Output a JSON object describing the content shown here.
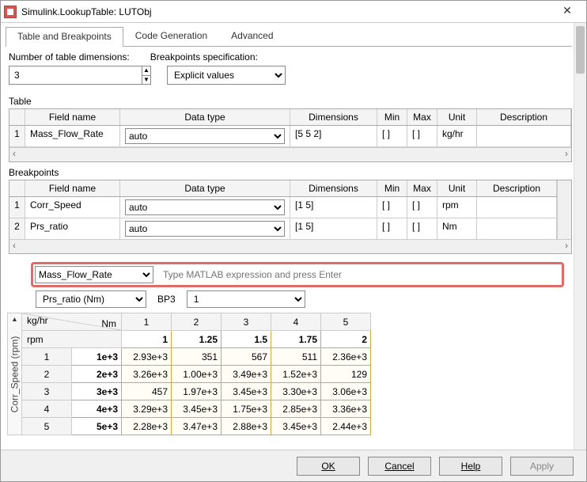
{
  "window": {
    "title": "Simulink.LookupTable: LUTObj"
  },
  "tabs": {
    "t1": "Table and Breakpoints",
    "t2": "Code Generation",
    "t3": "Advanced"
  },
  "labels": {
    "numDims": "Number of table dimensions:",
    "bpSpec": "Breakpoints specification:",
    "table": "Table",
    "breakpoints": "Breakpoints",
    "bp3": "BP3",
    "yaxis": "Corr_Speed (rpm)"
  },
  "inputs": {
    "numDims": "3",
    "bpSpec": "Explicit values",
    "exprSelect": "Mass_Flow_Rate",
    "exprPlaceholder": "Type MATLAB expression and press Enter",
    "filter1": "Prs_ratio (Nm)",
    "bp3val": "1"
  },
  "headers": {
    "fieldName": "Field name",
    "dataType": "Data type",
    "dimensions": "Dimensions",
    "min": "Min",
    "max": "Max",
    "unit": "Unit",
    "description": "Description"
  },
  "tableRows": [
    {
      "idx": "1",
      "fn": "Mass_Flow_Rate",
      "dt": "auto",
      "dim": "[5 5 2]",
      "min": "[ ]",
      "max": "[ ]",
      "unit": "kg/hr",
      "desc": ""
    }
  ],
  "bpRows": [
    {
      "idx": "1",
      "fn": "Corr_Speed",
      "dt": "auto",
      "dim": "[1 5]",
      "min": "[ ]",
      "max": "[ ]",
      "unit": "rpm",
      "desc": ""
    },
    {
      "idx": "2",
      "fn": "Prs_ratio",
      "dt": "auto",
      "dim": "[1 5]",
      "min": "[ ]",
      "max": "[ ]",
      "unit": "Nm",
      "desc": ""
    }
  ],
  "dataGrid": {
    "cornerTL": "kg/hr",
    "cornerBR": "Nm",
    "rowUnit": "rpm",
    "colIdx": [
      "1",
      "2",
      "3",
      "4",
      "5"
    ],
    "colBP": [
      "1",
      "1.25",
      "1.5",
      "1.75",
      "2"
    ],
    "rowIdx": [
      "1",
      "2",
      "3",
      "4",
      "5"
    ],
    "rowBP": [
      "1e+3",
      "2e+3",
      "3e+3",
      "4e+3",
      "5e+3"
    ],
    "cells": [
      [
        "2.93e+3",
        "351",
        "567",
        "511",
        "2.36e+3"
      ],
      [
        "3.26e+3",
        "1.00e+3",
        "3.49e+3",
        "1.52e+3",
        "129"
      ],
      [
        "457",
        "1.97e+3",
        "3.45e+3",
        "3.30e+3",
        "3.06e+3"
      ],
      [
        "3.29e+3",
        "3.45e+3",
        "1.75e+3",
        "2.85e+3",
        "3.36e+3"
      ],
      [
        "2.28e+3",
        "3.47e+3",
        "2.88e+3",
        "3.45e+3",
        "2.44e+3"
      ]
    ]
  },
  "buttons": {
    "ok": "OK",
    "cancel": "Cancel",
    "help": "Help",
    "apply": "Apply"
  }
}
